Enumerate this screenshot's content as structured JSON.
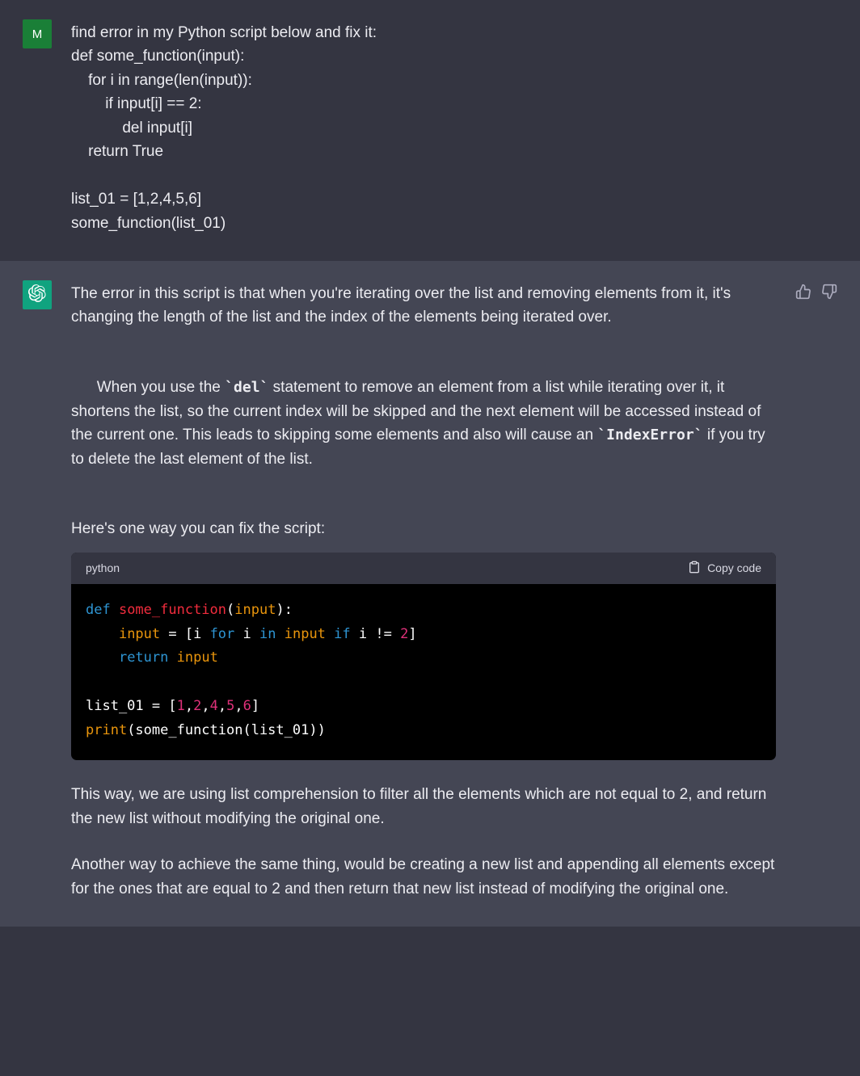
{
  "user": {
    "avatar_letter": "M",
    "message": "find error in my Python script below and fix it:\ndef some_function(input):\n    for i in range(len(input)):\n        if input[i] == 2:\n            del input[i]\n    return True\n\nlist_01 = [1,2,4,5,6]\nsome_function(list_01)"
  },
  "assistant": {
    "para1_a": "The error in this script is that when you're iterating over the list and removing elements from it, it's changing the length of the list and the index of the elements being iterated over.",
    "para2_a": "When you use the ",
    "para2_code1": "`del`",
    "para2_b": " statement to remove an element from a list while iterating over it, it shortens the list, so the current index will be skipped and the next element will be accessed instead of the current one. This leads to skipping some elements and also will cause an ",
    "para2_code2": "`IndexError`",
    "para2_c": " if you try to delete the last element of the list.",
    "para3": "Here's one way you can fix the script:",
    "code": {
      "lang": "python",
      "copy_label": "Copy code",
      "l1_def": "def",
      "l1_fn": " some_function",
      "l1_open": "(",
      "l1_arg": "input",
      "l1_close": "):",
      "l2_indent": "    ",
      "l2_input": "input",
      "l2_eq": " = [i ",
      "l2_for": "for",
      "l2_i": " i ",
      "l2_in": "in",
      "l2_input2": " ",
      "l2_input2b": "input",
      "l2_if": " ",
      "l2_ifkw": "if",
      "l2_cond": " i != ",
      "l2_two": "2",
      "l2_br": "]",
      "l3_indent": "    ",
      "l3_ret": "return",
      "l3_input": " ",
      "l3_inputw": "input",
      "l5_a": "list_01 = [",
      "l5_n1": "1",
      "l5_c1": ",",
      "l5_n2": "2",
      "l5_c2": ",",
      "l5_n3": "4",
      "l5_c3": ",",
      "l5_n4": "5",
      "l5_c4": ",",
      "l5_n5": "6",
      "l5_b": "]",
      "l6_print": "print",
      "l6_open": "(some_function(list_01))"
    },
    "para4": "This way, we are using list comprehension to filter all the elements which are not equal to 2, and return the new list without modifying the original one.",
    "para5": "Another way to achieve the same thing, would be creating a new list and appending all elements except for the ones that are equal to 2 and then return that new list instead of modifying the original one."
  }
}
